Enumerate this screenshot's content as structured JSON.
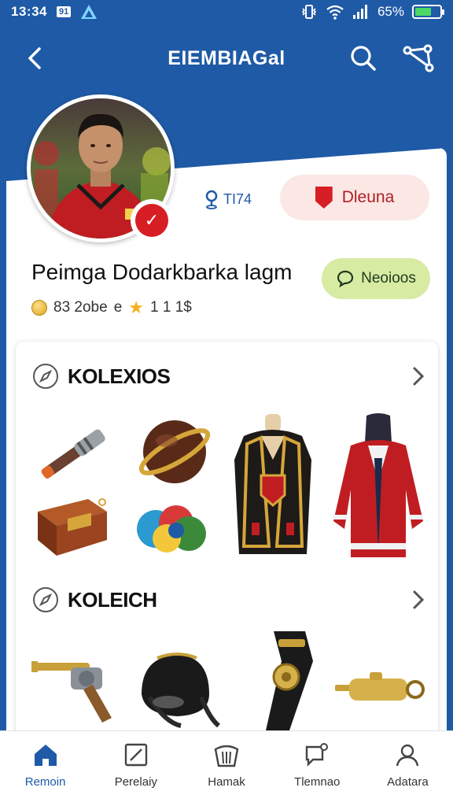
{
  "status_bar": {
    "time": "13:34",
    "notification_badge": "91",
    "battery_percent": "65%",
    "battery_level": 0.65
  },
  "header": {
    "title": "EIEMBIAGal"
  },
  "profile": {
    "location_stat": "TI74",
    "follow_label": "Dleuna",
    "name": "Peimga Dodarkbarka lagm",
    "message_label": "Neoioos",
    "coins": "83 2obe",
    "coins_suffix": "e",
    "rating": "1 1 1$"
  },
  "sections": [
    {
      "title": "KOLEXIOS"
    },
    {
      "title": "KOLEICH"
    }
  ],
  "nav": [
    {
      "label": "Remoin",
      "icon": "home-icon",
      "active": true
    },
    {
      "label": "Perelaiy",
      "icon": "edit-icon",
      "active": false
    },
    {
      "label": "Hamak",
      "icon": "basket-icon",
      "active": false
    },
    {
      "label": "Tlemnao",
      "icon": "chat-icon",
      "active": false
    },
    {
      "label": "Adatara",
      "icon": "profile-icon",
      "active": false
    }
  ],
  "colors": {
    "brand_blue": "#1f5aa6",
    "accent_red": "#d81e25",
    "follow_bg": "#fbe8e4",
    "message_bg": "#d7eba3"
  }
}
